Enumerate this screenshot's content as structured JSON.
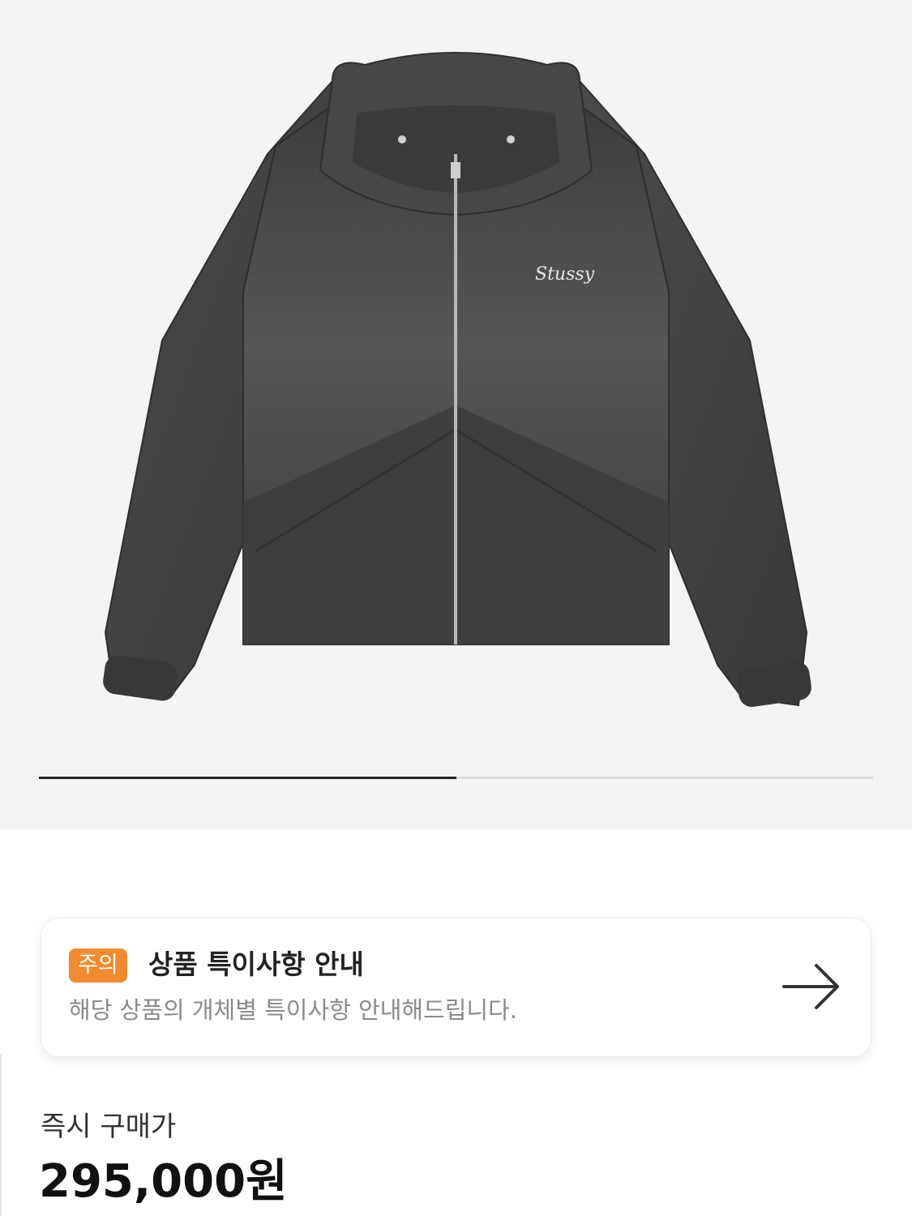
{
  "gallery": {
    "image_alt": "Stussy hooded zip-up nylon jacket, washed black",
    "logo_text": "Stussy",
    "pager": {
      "current": 1,
      "total": 2
    },
    "colors": {
      "background": "#f4f4f4",
      "pager_active": "#222222",
      "pager_track": "#dcdcdc"
    }
  },
  "notice": {
    "badge": "주의",
    "title": "상품 특이사항 안내",
    "description": "해당 상품의 개체별 특이사항 안내해드립니다.",
    "icon": "arrow-right-icon",
    "badge_color": "#f28a2e"
  },
  "price": {
    "label": "즉시 구매가",
    "value": "295,000원"
  }
}
